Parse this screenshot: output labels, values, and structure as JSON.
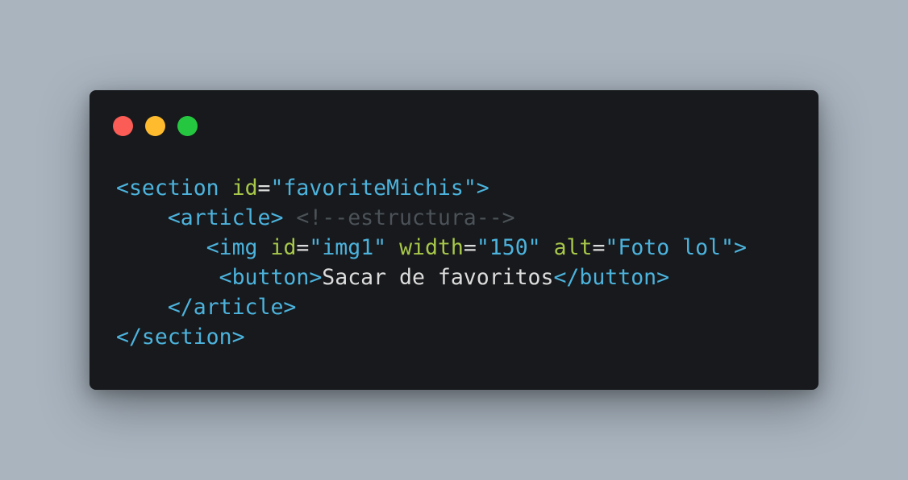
{
  "window": {
    "controls": {
      "close": {
        "icon": "close-icon",
        "color": "#fb5c55"
      },
      "minimize": {
        "icon": "minimize-icon",
        "color": "#febb2e"
      },
      "maximize": {
        "icon": "maximize-icon",
        "color": "#26c740"
      }
    }
  },
  "code": {
    "line1": {
      "open": "<section",
      "attr": "id",
      "eq": "=",
      "value": "\"favoriteMichis\"",
      "close": ">"
    },
    "line2": {
      "indent": "    ",
      "tag": "<article>",
      "comment": "<!--estructura-->"
    },
    "line3": {
      "indent": "       ",
      "open": "<img",
      "attr1": "id",
      "eq1": "=",
      "value1": "\"img1\"",
      "attr2": "width",
      "eq2": "=",
      "value2": "\"150\"",
      "attr3": "alt",
      "eq3": "=",
      "value3": "\"Foto lol\"",
      "close": ">"
    },
    "line4": {
      "indent": "        ",
      "open": "<button>",
      "text": "Sacar de favoritos",
      "close": "</button>"
    },
    "line5": {
      "indent": "    ",
      "tag": "</article>"
    },
    "line6": {
      "tag": "</section>"
    }
  },
  "colors": {
    "background": "#a9b4bf",
    "window": "#17191c",
    "tag": "#4cb3dd",
    "attribute": "#a8c84a",
    "comment": "#4b5258",
    "text": "#dcdcdc"
  }
}
